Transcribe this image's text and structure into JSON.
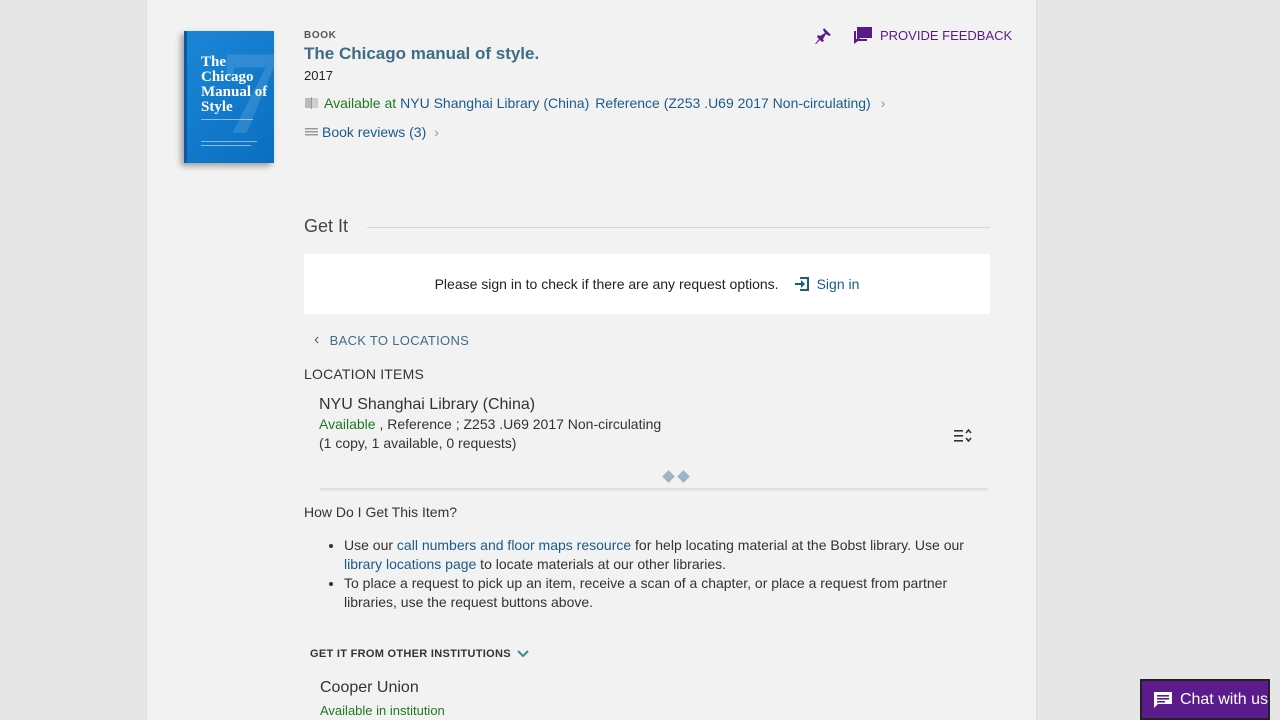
{
  "record": {
    "type_label": "BOOK",
    "title": "The Chicago manual of style.",
    "year": "2017",
    "availability_status": "Available at",
    "availability_location": "NYU Shanghai Library (China)",
    "availability_detail": "Reference (Z253 .U69 2017 Non-circulating)",
    "reviews_label": "Book reviews (3)",
    "cover_title": "The Chicago Manual of Style"
  },
  "actions": {
    "pin_icon": "pushpin-icon",
    "feedback_label": "PROVIDE FEEDBACK"
  },
  "get_it": {
    "section_title": "Get It",
    "signin_prompt": "Please sign in to check if there are any request options.",
    "signin_label": "Sign in",
    "back_label": "BACK TO LOCATIONS",
    "location_items_label": "LOCATION ITEMS",
    "location": {
      "name": "NYU Shanghai Library (China)",
      "status": "Available",
      "detail": " , Reference ; Z253 .U69 2017 Non-circulating",
      "copies": "(1 copy, 1 available, 0 requests)"
    }
  },
  "how_to": {
    "heading": "How Do I Get This Item?",
    "bullet1_pre": "Use our ",
    "bullet1_link1": "call numbers and floor maps resource",
    "bullet1_mid": " for help locating material at the Bobst library. Use our ",
    "bullet1_link2": "library locations page",
    "bullet1_post": " to locate materials at our other libraries.",
    "bullet2": "To place a request to pick up an item, receive a scan of a chapter, or place a request from partner libraries, use the request buttons above."
  },
  "other_institutions": {
    "label": "GET IT FROM OTHER INSTITUTIONS",
    "first_name": "Cooper Union",
    "first_status": "Available in institution"
  },
  "chat": {
    "label": "Chat with us"
  },
  "colors": {
    "accent_purple": "#5a1a8a",
    "link_blue": "#1a5b8a",
    "available_green": "#1e7a1e"
  }
}
